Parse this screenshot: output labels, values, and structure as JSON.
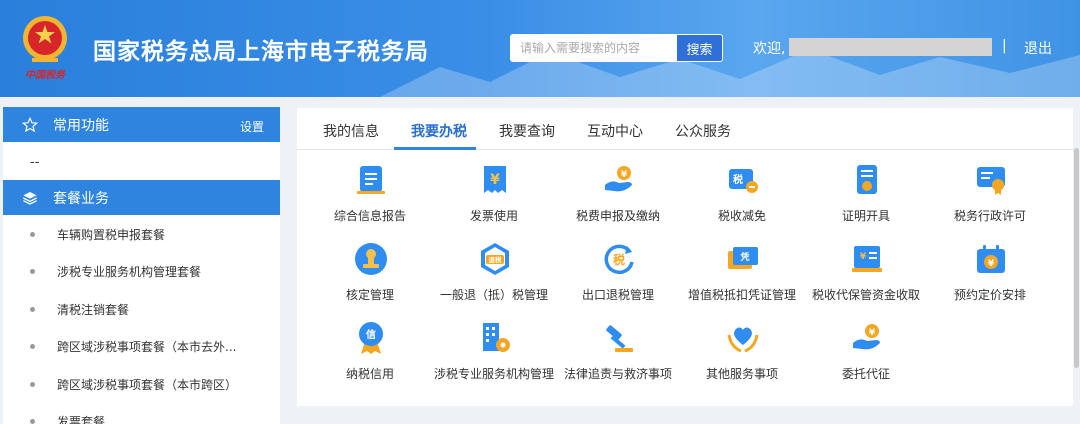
{
  "header": {
    "title": "国家税务总局上海市电子税务局",
    "emblem_text": "中国税务",
    "search": {
      "placeholder": "请输入需要搜索的内容",
      "value": "",
      "button_label": "搜索"
    },
    "welcome": "欢迎,",
    "separator": "|",
    "logout_label": "退出"
  },
  "sidebar": {
    "favorites": {
      "label": "常用功能",
      "settings_label": "设置",
      "icon": "star-icon",
      "empty_text": "--"
    },
    "packages": {
      "label": "套餐业务",
      "icon": "layers-icon",
      "items": [
        {
          "label": "车辆购置税申报套餐"
        },
        {
          "label": "涉税专业服务机构管理套餐"
        },
        {
          "label": "清税注销套餐"
        },
        {
          "label": "跨区域涉税事项套餐（本市去外..."
        },
        {
          "label": "跨区域涉税事项套餐（本市跨区）"
        },
        {
          "label": "发票套餐"
        }
      ]
    }
  },
  "main": {
    "tabs": [
      {
        "label": "我的信息"
      },
      {
        "label": "我要办税"
      },
      {
        "label": "我要查询"
      },
      {
        "label": "互动中心"
      },
      {
        "label": "公众服务"
      }
    ],
    "active_tab": "我要办税",
    "services": [
      {
        "label": "综合信息报告",
        "icon": "report-document-icon"
      },
      {
        "label": "发票使用",
        "icon": "invoice-yen-icon"
      },
      {
        "label": "税费申报及缴纳",
        "icon": "hand-coin-icon"
      },
      {
        "label": "税收减免",
        "icon": "tax-reduction-icon"
      },
      {
        "label": "证明开具",
        "icon": "certificate-icon"
      },
      {
        "label": "税务行政许可",
        "icon": "license-award-icon"
      },
      {
        "label": "核定管理",
        "icon": "stamp-icon"
      },
      {
        "label": "一般退（抵）税管理",
        "icon": "tax-refund-icon"
      },
      {
        "label": "出口退税管理",
        "icon": "export-refund-icon"
      },
      {
        "label": "增值税抵扣凭证管理",
        "icon": "voucher-icon"
      },
      {
        "label": "税收代保管资金收取",
        "icon": "fund-collection-icon"
      },
      {
        "label": "预约定价安排",
        "icon": "calendar-yen-icon"
      },
      {
        "label": "纳税信用",
        "icon": "credit-medal-icon"
      },
      {
        "label": "涉税专业服务机构管理",
        "icon": "building-gear-icon"
      },
      {
        "label": "法律追责与救济事项",
        "icon": "gavel-icon"
      },
      {
        "label": "其他服务事项",
        "icon": "heart-hands-icon"
      },
      {
        "label": "委托代征",
        "icon": "hand-coin-icon"
      }
    ]
  },
  "colors": {
    "header_blue": "#2a7fdc",
    "sidebar_head_blue": "#2f84e0",
    "active_tab_text": "#2a6fd0",
    "icon_blue": "#2f8cf0",
    "icon_orange": "#f5a623"
  }
}
